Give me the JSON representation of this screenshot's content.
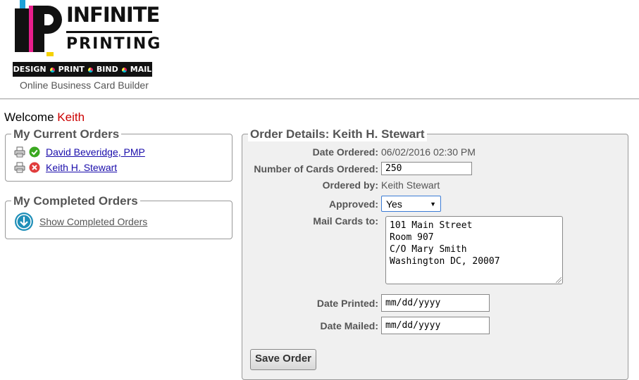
{
  "header": {
    "logo": {
      "brand_line1": "INFINITE",
      "brand_line2": "PRINTING",
      "tagline": [
        "DESIGN",
        "PRINT",
        "BIND",
        "MAIL"
      ]
    },
    "subtitle": "Online Business Card Builder"
  },
  "welcome": {
    "prefix": "Welcome",
    "name": "Keith"
  },
  "current_orders": {
    "legend": "My Current Orders",
    "items": [
      {
        "name": "David Beveridge, PMP",
        "status": "approved",
        "status_icon": "check-circle-icon"
      },
      {
        "name": "Keith H. Stewart",
        "status": "not-approved",
        "status_icon": "x-circle-icon"
      }
    ]
  },
  "completed_orders": {
    "legend": "My Completed Orders",
    "link": "Show Completed Orders"
  },
  "order_details": {
    "legend": "Order Details: Keith H. Stewart",
    "date_ordered": {
      "label": "Date Ordered:",
      "value": "06/02/2016 02:30 PM"
    },
    "num_cards": {
      "label": "Number of Cards Ordered:",
      "value": "250"
    },
    "ordered_by": {
      "label": "Ordered by:",
      "value": "Keith Stewart"
    },
    "approved": {
      "label": "Approved:",
      "value": "Yes"
    },
    "mail_to": {
      "label": "Mail Cards to:",
      "lines": [
        "101 Main Street",
        "Room 907",
        "C/O Mary Smith",
        "Washington DC, 20007"
      ]
    },
    "date_printed": {
      "label": "Date Printed:",
      "placeholder": "mm/dd/yyyy"
    },
    "date_mailed": {
      "label": "Date Mailed:",
      "placeholder": "mm/dd/yyyy"
    },
    "save_label": "Save Order"
  },
  "colors": {
    "welcome_name": "#cc0000",
    "link": "#1a0dab",
    "approved": "#3aa820",
    "rejected": "#e03c3c",
    "completed_icon": "#1f8fb8"
  }
}
